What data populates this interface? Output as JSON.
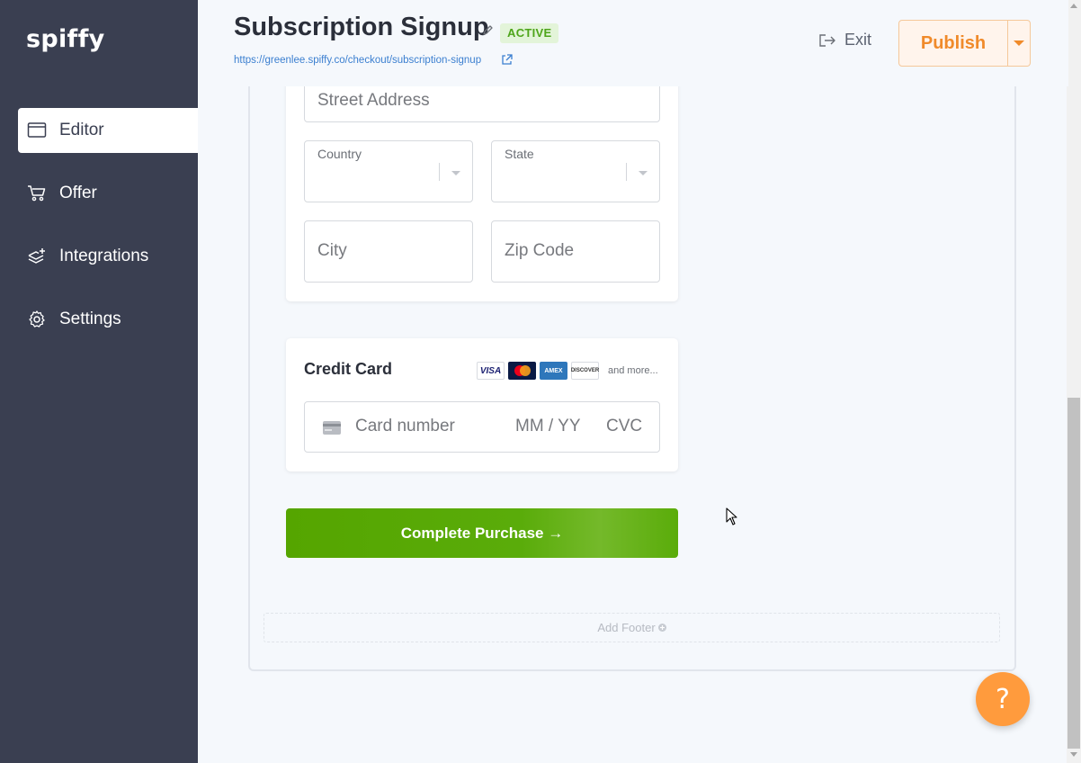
{
  "app": {
    "logo": "spiffy"
  },
  "sidebar": {
    "items": [
      {
        "label": "Editor",
        "icon": "browser-window-icon",
        "active": true
      },
      {
        "label": "Offer",
        "icon": "cart-icon",
        "active": false
      },
      {
        "label": "Integrations",
        "icon": "layers-plus-icon",
        "active": false
      },
      {
        "label": "Settings",
        "icon": "gear-icon",
        "active": false
      }
    ]
  },
  "header": {
    "title": "Subscription Signup",
    "status": "ACTIVE",
    "url": "https://greenlee.spiffy.co/checkout/subscription-signup",
    "exit_label": "Exit",
    "publish_label": "Publish"
  },
  "address_form": {
    "street_placeholder": "Street Address",
    "country_label": "Country",
    "state_label": "State",
    "city_placeholder": "City",
    "zip_placeholder": "Zip Code"
  },
  "payment": {
    "title": "Credit Card",
    "brands": [
      "VISA",
      "Mastercard",
      "AMEX",
      "DISCOVER"
    ],
    "and_more": "and more...",
    "card_number_placeholder": "Card number",
    "expiry_placeholder": "MM / YY",
    "cvc_placeholder": "CVC"
  },
  "actions": {
    "complete_label": "Complete Purchase →",
    "add_footer_label": "Add Footer"
  },
  "help": {
    "label": "?"
  },
  "colors": {
    "sidebar_bg": "#3a3f51",
    "accent_orange": "#f08a2a",
    "complete_green": "#55a500",
    "status_green": "#4ea51a"
  }
}
